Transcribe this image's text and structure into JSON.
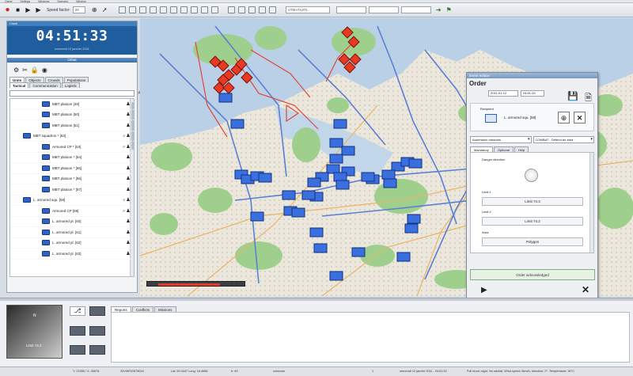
{
  "menu": [
    "Game",
    "Settings",
    "Windows",
    "Scenario",
    "Window"
  ],
  "toolbar": {
    "speed_label": "Speed factor:",
    "speed_value": "20",
    "mode_value": "UTM-ITA/ITL",
    "color_accent": "#1f5d9e"
  },
  "clock": {
    "title": "Clock",
    "time": "04:51:33",
    "date": "mercredi 12 janvier 2011"
  },
  "orbat": {
    "title": "Orbat",
    "tabs": [
      "Units",
      "Objects",
      "Crowds",
      "Populations"
    ],
    "subtabs": [
      "Tactical",
      "Communication",
      "Logistic"
    ],
    "rows": [
      {
        "label": "MBT platoon [49]",
        "indent": 3,
        "flag": ""
      },
      {
        "label": "MBT platoon [50]",
        "indent": 3,
        "flag": ""
      },
      {
        "label": "MBT platoon [51]",
        "indent": 3,
        "flag": ""
      },
      {
        "label": "MBT squadron * [53]",
        "indent": 1,
        "flag": "S"
      },
      {
        "label": "Armored CP * [53]",
        "indent": 3,
        "flag": "P"
      },
      {
        "label": "MBT platoon * [54]",
        "indent": 3,
        "flag": ""
      },
      {
        "label": "MBT platoon * [55]",
        "indent": 3,
        "flag": ""
      },
      {
        "label": "MBT platoon * [56]",
        "indent": 3,
        "flag": ""
      },
      {
        "label": "MBT platoon * [57]",
        "indent": 3,
        "flag": ""
      },
      {
        "label": "L. armored squ. [58]",
        "indent": 1,
        "flag": "S"
      },
      {
        "label": "Armored CP [59]",
        "indent": 3,
        "flag": "P"
      },
      {
        "label": "L. armored pl. [60]",
        "indent": 3,
        "flag": ""
      },
      {
        "label": "L. armored pl. [61]",
        "indent": 3,
        "flag": ""
      },
      {
        "label": "L. armored pl. [62]",
        "indent": 3,
        "flag": ""
      },
      {
        "label": "L. armored pl. [63]",
        "indent": 3,
        "flag": ""
      }
    ]
  },
  "order": {
    "window_title": "Event edition",
    "title": "Order",
    "date": "2011-01-12",
    "time": "04:51:33",
    "recipient_label": "Recipient",
    "recipient_name": "L. armored squ. [58]",
    "mission_type": "Automaton missions",
    "mission": "COMBAT - Defend an area",
    "tabs": [
      "Mandatory",
      "Optional",
      "Help"
    ],
    "danger_label": "Danger direction",
    "limit1_label": "Limit 1",
    "limit1_value": "Limit 74.3",
    "limit2_label": "Limit 2",
    "limit2_value": "Limit 74.2",
    "area_label": "Area",
    "area_value": "Polygon",
    "ack_label": "Order acknowledged"
  },
  "minimap": {
    "caption": "Limit 74.2",
    "arrow": "N"
  },
  "log": {
    "tabs": [
      "Reports",
      "Conflicts",
      "Missions"
    ]
  },
  "status": {
    "f1": "Y: 22355 / X: 45678",
    "f2": "33VWE02878024",
    "f3": "Lat: 59.4447 Long: 16.4666",
    "f4": "h: 49",
    "f5": "unknown",
    "f6": "1",
    "f7": "mercredi 12 janvier 2011 - 04:51:33",
    "f8": "Full moon night. No rainfall. Wind speed: 8km/h, direction: 0°. Temperature: 30°C"
  },
  "map_meta": {
    "slider_progress": 0.78
  }
}
